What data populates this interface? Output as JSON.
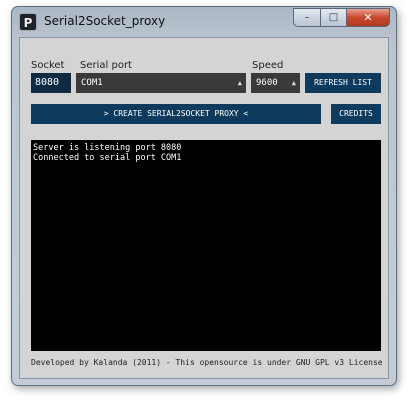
{
  "window": {
    "title": "Serial2Socket_proxy",
    "icon_letter": "P",
    "minimize_glyph": "–",
    "maximize_glyph": "□",
    "close_glyph": "✕"
  },
  "form": {
    "socket_label": "Socket",
    "socket_value": "8080",
    "serial_port_label": "Serial port",
    "serial_port_value": "COM1",
    "speed_label": "Speed",
    "speed_value": "9600",
    "dropdown_arrow_icon": "chevron-up-icon",
    "refresh_label": "REFRESH LIST"
  },
  "actions": {
    "create_label": "> CREATE SERIAL2SOCKET PROXY <",
    "credits_label": "CREDITS"
  },
  "console": {
    "lines": [
      "Server is listening port 8080",
      "Connected to serial port COM1"
    ]
  },
  "footer": {
    "text": "Developed by Kalanda (2011) - This opensource is under GNU GPL v3 License"
  },
  "colors": {
    "accent": "#0e3a5e",
    "console_bg": "#000000",
    "panel_bg": "#d4d4d4"
  }
}
